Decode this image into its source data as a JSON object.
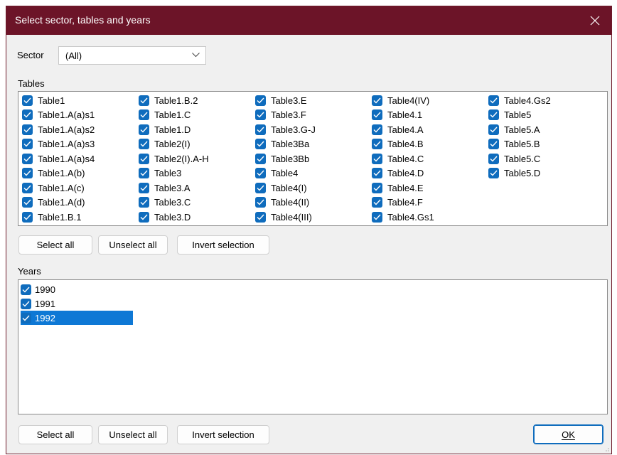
{
  "window": {
    "title": "Select sector, tables and years"
  },
  "sector": {
    "label": "Sector",
    "value": "(All)"
  },
  "tables": {
    "label": "Tables",
    "columns": [
      [
        {
          "label": "Table1",
          "checked": true
        },
        {
          "label": "Table1.A(a)s1",
          "checked": true
        },
        {
          "label": "Table1.A(a)s2",
          "checked": true
        },
        {
          "label": "Table1.A(a)s3",
          "checked": true
        },
        {
          "label": "Table1.A(a)s4",
          "checked": true
        },
        {
          "label": "Table1.A(b)",
          "checked": true
        },
        {
          "label": "Table1.A(c)",
          "checked": true
        },
        {
          "label": "Table1.A(d)",
          "checked": true
        },
        {
          "label": "Table1.B.1",
          "checked": true
        }
      ],
      [
        {
          "label": "Table1.B.2",
          "checked": true
        },
        {
          "label": "Table1.C",
          "checked": true
        },
        {
          "label": "Table1.D",
          "checked": true
        },
        {
          "label": "Table2(I)",
          "checked": true
        },
        {
          "label": "Table2(I).A-H",
          "checked": true
        },
        {
          "label": "Table3",
          "checked": true
        },
        {
          "label": "Table3.A",
          "checked": true
        },
        {
          "label": "Table3.C",
          "checked": true
        },
        {
          "label": "Table3.D",
          "checked": true
        }
      ],
      [
        {
          "label": "Table3.E",
          "checked": true
        },
        {
          "label": "Table3.F",
          "checked": true
        },
        {
          "label": "Table3.G-J",
          "checked": true
        },
        {
          "label": "Table3Ba",
          "checked": true
        },
        {
          "label": "Table3Bb",
          "checked": true
        },
        {
          "label": "Table4",
          "checked": true
        },
        {
          "label": "Table4(I)",
          "checked": true
        },
        {
          "label": "Table4(II)",
          "checked": true
        },
        {
          "label": "Table4(III)",
          "checked": true
        }
      ],
      [
        {
          "label": "Table4(IV)",
          "checked": true
        },
        {
          "label": "Table4.1",
          "checked": true
        },
        {
          "label": "Table4.A",
          "checked": true
        },
        {
          "label": "Table4.B",
          "checked": true
        },
        {
          "label": "Table4.C",
          "checked": true
        },
        {
          "label": "Table4.D",
          "checked": true
        },
        {
          "label": "Table4.E",
          "checked": true
        },
        {
          "label": "Table4.F",
          "checked": true
        },
        {
          "label": "Table4.Gs1",
          "checked": true
        }
      ],
      [
        {
          "label": "Table4.Gs2",
          "checked": true
        },
        {
          "label": "Table5",
          "checked": true
        },
        {
          "label": "Table5.A",
          "checked": true
        },
        {
          "label": "Table5.B",
          "checked": true
        },
        {
          "label": "Table5.C",
          "checked": true
        },
        {
          "label": "Table5.D",
          "checked": true
        }
      ]
    ],
    "buttons": {
      "select_all": "Select all",
      "unselect_all": "Unselect all",
      "invert": "Invert selection"
    }
  },
  "years": {
    "label": "Years",
    "items": [
      {
        "label": "1990",
        "checked": true,
        "selected": false
      },
      {
        "label": "1991",
        "checked": true,
        "selected": false
      },
      {
        "label": "1992",
        "checked": true,
        "selected": true
      }
    ],
    "buttons": {
      "select_all": "Select all",
      "unselect_all": "Unselect all",
      "invert": "Invert selection"
    }
  },
  "ok_label": "OK",
  "colors": {
    "titlebar": "#6c1428",
    "accent": "#0f6cbd",
    "selection": "#0e78d5"
  },
  "icons": {
    "close": "close-icon",
    "dropdown": "chevron-down-icon",
    "check": "checkmark-icon"
  }
}
